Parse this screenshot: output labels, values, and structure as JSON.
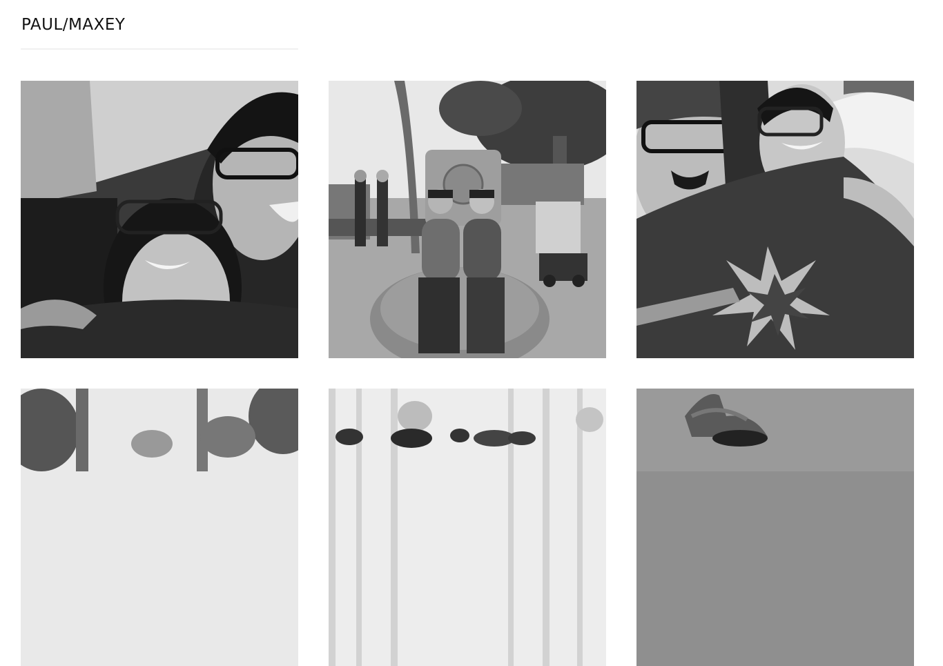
{
  "site": {
    "title": "PAUL/MAXEY"
  },
  "gallery": {
    "photos": [
      {
        "name": "photo-couple-selfie-booth"
      },
      {
        "name": "photo-couple-sitting-stone-cross"
      },
      {
        "name": "photo-couple-with-flag"
      },
      {
        "name": "photo-palm-trees"
      },
      {
        "name": "photo-flowers-curtains"
      },
      {
        "name": "photo-person-hat-closeup"
      }
    ]
  }
}
